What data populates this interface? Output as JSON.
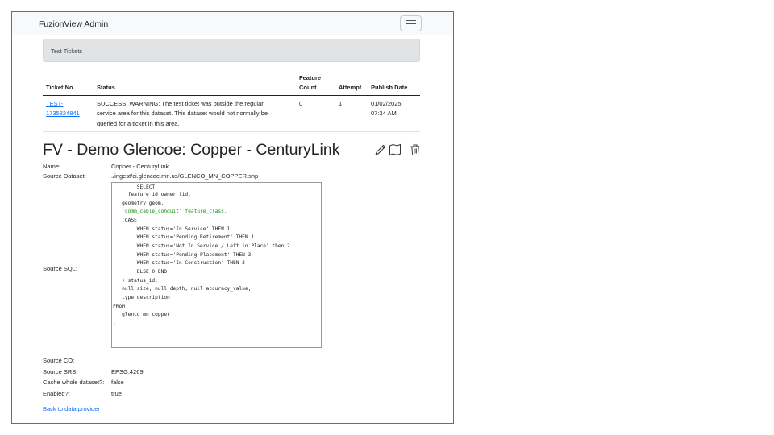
{
  "app": {
    "brand": "FuzionView Admin"
  },
  "alert": {
    "text": "Test Tickets"
  },
  "table": {
    "headers": {
      "ticket_no": "Ticket No.",
      "status": "Status",
      "feature_count_1": "Feature",
      "feature_count_2": "Count",
      "attempt": "Attempt",
      "publish_date": "Publish Date"
    },
    "rows": [
      {
        "ticket_1": "TEST-",
        "ticket_2": "1735824841",
        "status_1": "SUCCESS: WARNING: The test ticket was outside the regular",
        "status_2": "service area for this dataset. This dataset would not normally be",
        "status_3": "queried for a ticket in this area.",
        "feature_count": "0",
        "attempt": "1",
        "date_1": "01/02/2025",
        "date_2": "07:34 AM"
      }
    ]
  },
  "dataset": {
    "title": "FV - Demo Glencoe: Copper - CenturyLink",
    "labels": {
      "name": "Name:",
      "source_dataset": "Source Dataset:",
      "source_sql": "Source SQL:",
      "source_co": "Source CO:",
      "source_srs": "Source SRS:",
      "cache": "Cache whole dataset?:",
      "enabled": "Enabled?:"
    },
    "values": {
      "name": "Copper - CenturyLink",
      "source_dataset": "./ingest/ci.glencoe.mn.us/GLENCO_MN_COPPER.shp",
      "source_co": "",
      "source_srs": "EPSG:4269",
      "cache": "false",
      "enabled": "true"
    },
    "sql_lines": [
      "        SELECT",
      "     feature_id owner_fid,",
      "   geometry geom,",
      "   'comm_cable_conduit' feature_class,",
      "   (CASE",
      "        WHEN status='In Service' THEN 1",
      "        WHEN status='Pending Retirement' THEN 1",
      "        WHEN status='Not In Service / Left in Place' then 2",
      "        WHEN status='Pending Placement' THEN 3",
      "        WHEN status='In Construction' THEN 3",
      "        ELSE 0 END",
      "   ) status_id,",
      "   null size, null depth, null accuracy_value,",
      "   type description",
      "FROM",
      "   glenco_mn_copper",
      ";"
    ]
  },
  "footer": {
    "back_link": "Back to data provider"
  },
  "icons": [
    "pencil-icon",
    "map-icon",
    "trash-icon"
  ],
  "colors": {
    "link": "#0d6efd",
    "alert_bg": "#e2e3e5",
    "navbar_bg": "#f8f9fa",
    "sql_string": "#1a8d1a"
  }
}
